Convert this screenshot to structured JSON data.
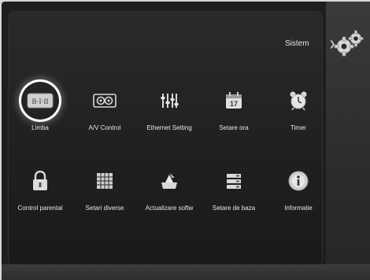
{
  "header": {
    "section_title": "Sistem"
  },
  "colors": {
    "background": "#1e1e1e",
    "text": "#e8e8e8",
    "highlight": "#ffffff"
  },
  "menu": {
    "selected_index": 0,
    "items": [
      {
        "label": "Limba",
        "icon": "language-icon"
      },
      {
        "label": "A/V Control",
        "icon": "av-control-icon"
      },
      {
        "label": "Ethernet Setting",
        "icon": "equalizer-icon"
      },
      {
        "label": "Setare ora",
        "icon": "calendar-icon",
        "icon_text": "17"
      },
      {
        "label": "Timer",
        "icon": "alarm-clock-icon"
      },
      {
        "label": "Control parental",
        "icon": "padlock-icon"
      },
      {
        "label": "Setari diverse",
        "icon": "grid-icon"
      },
      {
        "label": "Actualizare softw",
        "icon": "update-icon"
      },
      {
        "label": "Setare de baza",
        "icon": "storage-icon"
      },
      {
        "label": "Informatie",
        "icon": "info-disc-icon"
      }
    ]
  }
}
